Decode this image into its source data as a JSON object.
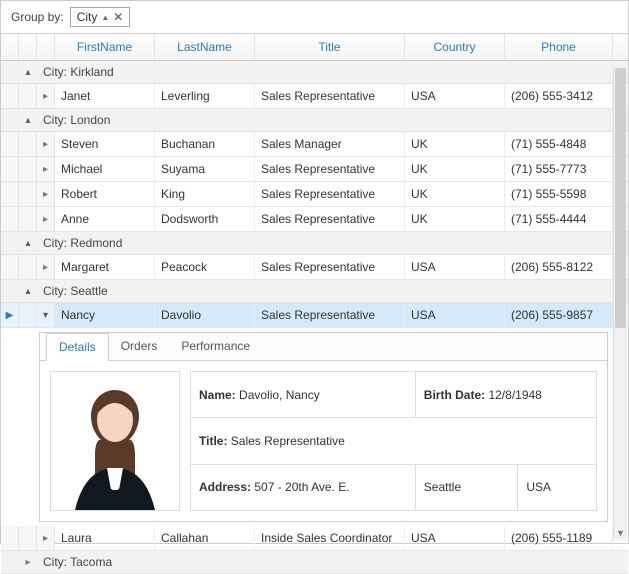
{
  "groupby": {
    "label": "Group by:",
    "field": "City"
  },
  "columns": [
    "FirstName",
    "LastName",
    "Title",
    "Country",
    "Phone"
  ],
  "groups": [
    {
      "label": "City: Kirkland",
      "expanded": true,
      "rows": [
        {
          "first": "Janet",
          "last": "Leverling",
          "title": "Sales Representative",
          "country": "USA",
          "phone": "(206) 555-3412"
        }
      ]
    },
    {
      "label": "City: London",
      "expanded": true,
      "rows": [
        {
          "first": "Steven",
          "last": "Buchanan",
          "title": "Sales Manager",
          "country": "UK",
          "phone": "(71) 555-4848"
        },
        {
          "first": "Michael",
          "last": "Suyama",
          "title": "Sales Representative",
          "country": "UK",
          "phone": "(71) 555-7773"
        },
        {
          "first": "Robert",
          "last": "King",
          "title": "Sales Representative",
          "country": "UK",
          "phone": "(71) 555-5598"
        },
        {
          "first": "Anne",
          "last": "Dodsworth",
          "title": "Sales Representative",
          "country": "UK",
          "phone": "(71) 555-4444"
        }
      ]
    },
    {
      "label": "City: Redmond",
      "expanded": true,
      "rows": [
        {
          "first": "Margaret",
          "last": "Peacock",
          "title": "Sales Representative",
          "country": "USA",
          "phone": "(206) 555-8122"
        }
      ]
    },
    {
      "label": "City: Seattle",
      "expanded": true,
      "rows": [
        {
          "first": "Nancy",
          "last": "Davolio",
          "title": "Sales Representative",
          "country": "USA",
          "phone": "(206) 555-9857",
          "selected": true,
          "expanded": true
        },
        {
          "first": "Laura",
          "last": "Callahan",
          "title": "Inside Sales Coordinator",
          "country": "USA",
          "phone": "(206) 555-1189"
        }
      ]
    },
    {
      "label": "City: Tacoma",
      "expanded": false,
      "rows": []
    }
  ],
  "detail": {
    "tabs": [
      "Details",
      "Orders",
      "Performance"
    ],
    "activeTab": 0,
    "name_label": "Name:",
    "name_value": "Davolio, Nancy",
    "birth_label": "Birth Date:",
    "birth_value": "12/8/1948",
    "title_label": "Title:",
    "title_value": "Sales Representative",
    "addr_label": "Address:",
    "addr_value": "507 - 20th Ave. E.",
    "city_value": "Seattle",
    "country_value": "USA"
  }
}
